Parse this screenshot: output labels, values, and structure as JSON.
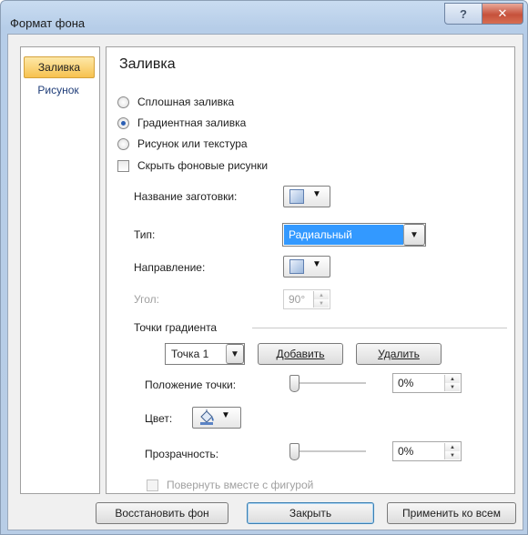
{
  "window": {
    "title": "Формат фона",
    "help_glyph": "?",
    "close_glyph": "✕"
  },
  "nav": {
    "items": [
      {
        "label": "Заливка",
        "selected": true
      },
      {
        "label": "Рисунок",
        "selected": false
      }
    ]
  },
  "fill": {
    "section_title": "Заливка",
    "options": [
      {
        "label": "Сплошная заливка",
        "checked": false
      },
      {
        "label": "Градиентная заливка",
        "checked": true
      },
      {
        "label": "Рисунок или текстура",
        "checked": false
      }
    ],
    "hide_background": {
      "label": "Скрыть фоновые рисунки",
      "checked": false
    },
    "preset": {
      "label": "Название заготовки:"
    },
    "type": {
      "label": "Тип:",
      "value": "Радиальный"
    },
    "direction": {
      "label": "Направление:"
    },
    "angle": {
      "label": "Угол:",
      "value": "90°"
    },
    "stops": {
      "label": "Точки градиента",
      "current": "Точка 1",
      "add_label": "Добавить",
      "remove_label": "Удалить",
      "position_label": "Положение точки:",
      "position_value": "0%",
      "position_fraction": 0.0,
      "color_label": "Цвет:",
      "transparency_label": "Прозрачность:",
      "transparency_value": "0%",
      "transparency_fraction": 0.0
    },
    "rotate_with_shape": {
      "label": "Повернуть вместе с фигурой",
      "checked": false,
      "disabled": true
    }
  },
  "footer": {
    "reset_label": "Восстановить фон",
    "close_label": "Закрыть",
    "apply_all_label": "Применить ко всем"
  },
  "icons": {
    "gradient_swatch": "gradient-swatch-icon",
    "paint_bucket": "paint-bucket-icon",
    "dropdown_arrow": "▼",
    "spin_up": "▲",
    "spin_down": "▼"
  },
  "colors": {
    "accent_selection": "#3399ff",
    "nav_selected": "#f7c24f",
    "titlebar": "#c9dcf1",
    "close_button": "#c6513b"
  }
}
